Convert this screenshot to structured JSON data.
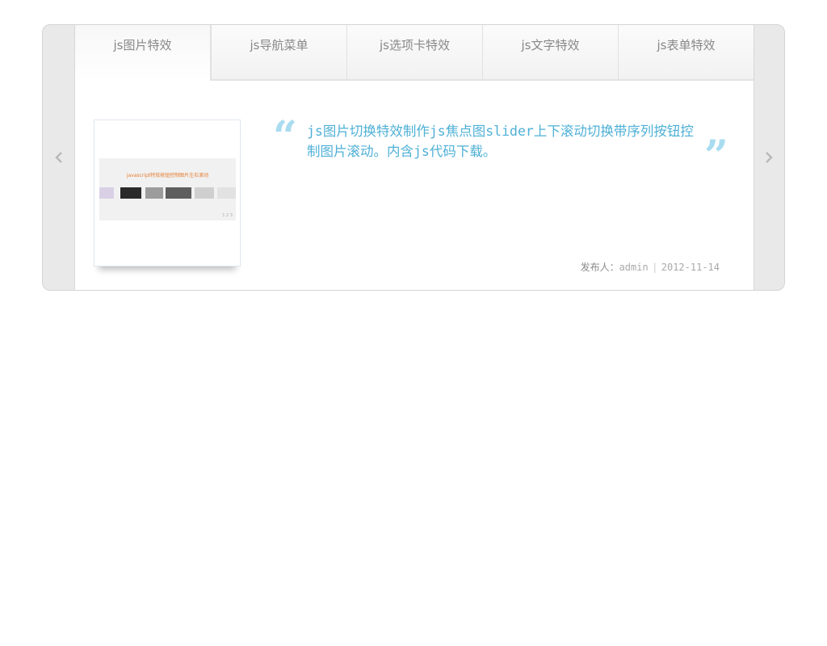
{
  "tabs": [
    {
      "label": "js图片特效",
      "active": true
    },
    {
      "label": "js导航菜单",
      "active": false
    },
    {
      "label": "js选项卡特效",
      "active": false
    },
    {
      "label": "js文字特效",
      "active": false
    },
    {
      "label": "js表单特效",
      "active": false
    }
  ],
  "arrows": {
    "prev_icon": "chevron-left-icon",
    "next_icon": "chevron-right-icon"
  },
  "item": {
    "thumbnail_caption": "javascript特效按钮控制图片左右滚动",
    "thumbnail_dots": "1 2 3",
    "description": "js图片切换特效制作js焦点图slider上下滚动切换带序列按钮控制图片滚动。内含js代码下载。",
    "author_label": "发布人：",
    "author": "admin",
    "date": "2012-11-14"
  },
  "colors": {
    "quote_text": "#4eb0d6",
    "quote_marks": "#a9dcf0",
    "tab_text": "#888888"
  }
}
